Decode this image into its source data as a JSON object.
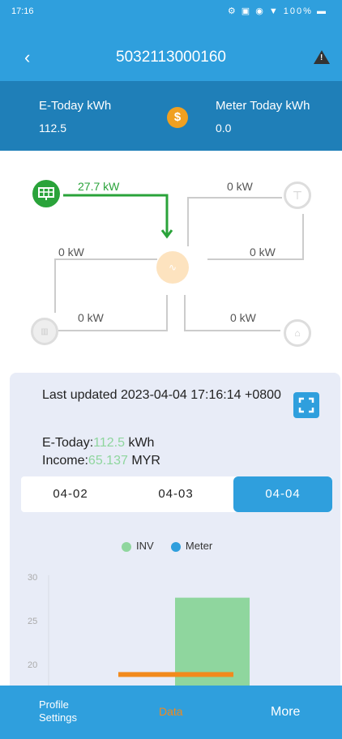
{
  "status_bar": {
    "time": "17:16",
    "icons": "⚙ ▣ ◉ ▼ 100% ▬"
  },
  "header": {
    "title": "5032113000160"
  },
  "summary": {
    "etoday_label": "E-Today kWh",
    "etoday_value": "112.5",
    "meter_label": "Meter Today kWh",
    "meter_value": "0.0",
    "coin_symbol": "$"
  },
  "flow": {
    "pv_kw": "27.7 kW",
    "grid_kw": "0 kW",
    "left_kw": "0 kW",
    "right_kw": "0 kW",
    "battery_kw": "0 kW",
    "load_kw": "0 kW"
  },
  "panel": {
    "updated": "Last updated 2023-04-04 17:16:14 +0800",
    "etoday_label": "E-Today:",
    "etoday_value": "112.5",
    "etoday_unit": "kWh",
    "income_label": "Income:",
    "income_value": "65.137",
    "income_unit": "MYR",
    "dates": [
      "04-02",
      "04-03",
      "04-04"
    ],
    "selected_date": "04-04"
  },
  "chart_data": {
    "type": "bar",
    "series": [
      {
        "name": "INV",
        "color": "#8fd69e"
      },
      {
        "name": "Meter",
        "color": "#2f9fdd"
      }
    ],
    "yticks": [
      "30",
      "25",
      "20"
    ],
    "bars": [
      {
        "series": "INV",
        "value": 28
      },
      {
        "series": "Meter",
        "value": 19.5
      }
    ]
  },
  "nav": {
    "profile": "Profile",
    "settings": "Settings",
    "data": "Data",
    "more": "More"
  }
}
